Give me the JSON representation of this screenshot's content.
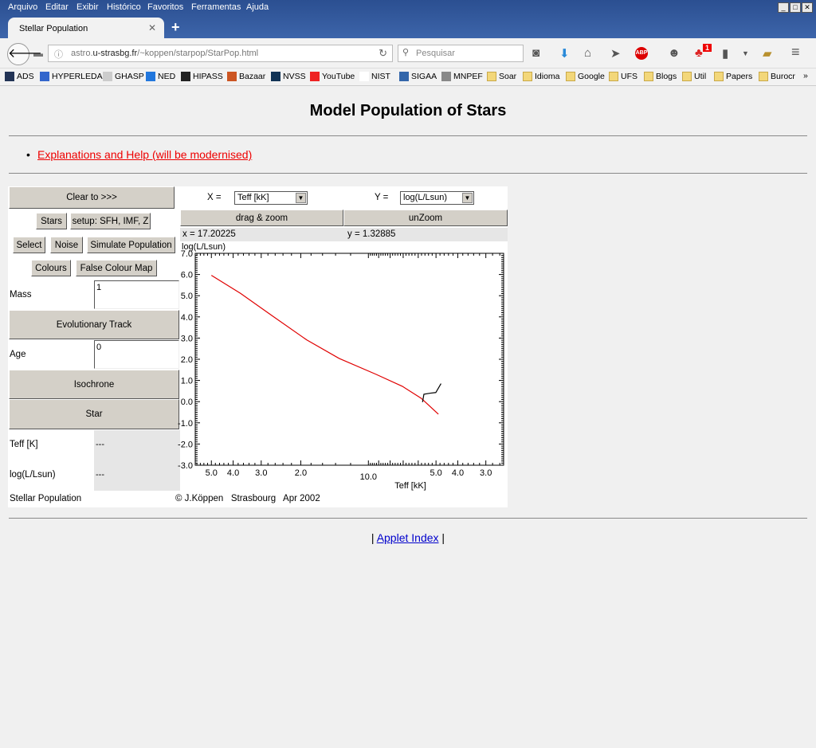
{
  "browser": {
    "menu": [
      "Arquivo",
      "Editar",
      "Exibir",
      "Histórico",
      "Favoritos",
      "Ferramentas",
      "Ajuda"
    ],
    "tab_title": "Stellar Population",
    "url_prefix": "astro.",
    "url_host": "u-strasbg.fr",
    "url_path": "/~koppen/starpop/StarPop.html",
    "search_placeholder": "Pesquisar",
    "notification_badge": "1",
    "bookmarks": [
      {
        "label": "ADS",
        "icon": "ads-icon"
      },
      {
        "label": "HYPERLEDA",
        "icon": "hyperleda-icon"
      },
      {
        "label": "GHASP",
        "icon": "ghasp-icon"
      },
      {
        "label": "NED",
        "icon": "ned-icon"
      },
      {
        "label": "HIPASS",
        "icon": "hipass-icon"
      },
      {
        "label": "Bazaar",
        "icon": "bazaar-icon"
      },
      {
        "label": "NVSS",
        "icon": "nvss-icon"
      },
      {
        "label": "YouTube",
        "icon": "youtube-icon"
      },
      {
        "label": "NIST",
        "icon": "nist-icon"
      },
      {
        "label": "SIGAA",
        "icon": "sigaa-icon"
      },
      {
        "label": "MNPEF",
        "icon": "globe-icon"
      },
      {
        "label": "Soar",
        "icon": "folder-icon"
      },
      {
        "label": "Idioma",
        "icon": "folder-icon"
      },
      {
        "label": "Google",
        "icon": "folder-icon"
      },
      {
        "label": "UFS",
        "icon": "folder-icon"
      },
      {
        "label": "Blogs",
        "icon": "folder-icon"
      },
      {
        "label": "Util",
        "icon": "folder-icon"
      },
      {
        "label": "Papers",
        "icon": "folder-icon"
      },
      {
        "label": "Burocr",
        "icon": "folder-icon"
      }
    ]
  },
  "page": {
    "title": "Model Population of Stars",
    "help_link": "Explanations and Help (will be modernised)",
    "applet_index_pre": "|",
    "applet_index": "Applet Index",
    "applet_index_post": "|"
  },
  "applet": {
    "clear": "Clear to >>>",
    "stars": "Stars",
    "setup": "setup: SFH, IMF, Z",
    "select": "Select",
    "noise": "Noise",
    "simulate": "Simulate Population",
    "colours": "Colours",
    "false_colour": "False Colour Map",
    "mass_label": "Mass",
    "mass_value": "1",
    "evol_track": "Evolutionary Track",
    "age_label": "Age",
    "age_value": "0",
    "isochrone": "Isochrone",
    "star": "Star",
    "teff_label": "Teff [K]",
    "teff_value": "---",
    "logl_label": "log(L/Lsun)",
    "logl_value": "---",
    "footer_left": "Stellar Population",
    "footer_right": "© J.Köppen   Strasbourg   Apr 2002",
    "x_label": "X =",
    "x_select": "Teff [kK]",
    "y_label": "Y =",
    "y_select": "log(L/Lsun)",
    "drag_zoom": "drag & zoom",
    "unzoom": "unZoom",
    "x_readout": "x = 17.20225",
    "y_readout": "y = 1.32885"
  },
  "chart_data": {
    "type": "line",
    "xlabel": "Teff [kK]",
    "ylabel": "log(L/Lsun)",
    "x_scale": "log-reversed",
    "xlim": [
      59,
      2.5
    ],
    "ylim": [
      -3,
      7
    ],
    "x_ticks": [
      {
        "v": 50,
        "label": "5.0"
      },
      {
        "v": 40,
        "label": "4.0"
      },
      {
        "v": 30,
        "label": "3.0"
      },
      {
        "v": 20,
        "label": "2.0"
      },
      {
        "v": 10,
        "label": "10.0"
      },
      {
        "v": 5,
        "label": "5.0"
      },
      {
        "v": 4,
        "label": "4.0"
      },
      {
        "v": 3,
        "label": "3.0"
      }
    ],
    "y_ticks": [
      "7.0",
      "6.0",
      "5.0",
      "4.0",
      "3.0",
      "2.0",
      "1.0",
      "0.0",
      "-1.0",
      "-2.0",
      "-3.0"
    ],
    "grid": false,
    "series": [
      {
        "color": "#e00000",
        "x": [
          50,
          37.1,
          26.7,
          18.8,
          13.5,
          9.25,
          7.05,
          5.82,
          4.88
        ],
        "y": [
          5.96,
          5.11,
          4.04,
          2.91,
          2.04,
          1.29,
          0.72,
          0.16,
          -0.59
        ]
      },
      {
        "color": "#000000",
        "x": [
          5.74,
          5.66,
          5.3,
          5.01,
          4.75
        ],
        "y": [
          -0.02,
          0.35,
          0.4,
          0.43,
          0.85
        ]
      }
    ]
  }
}
